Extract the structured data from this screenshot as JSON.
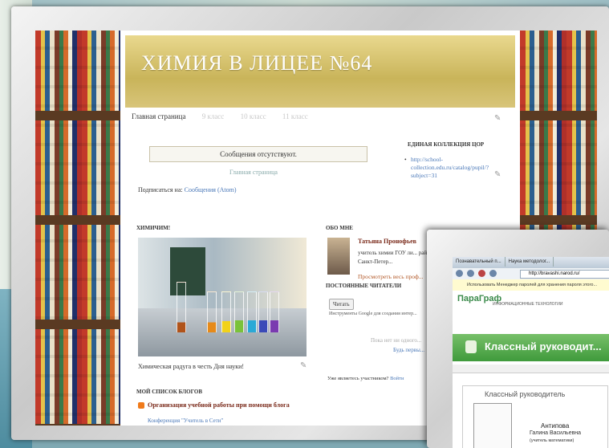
{
  "blog": {
    "title": "ХИМИЯ В ЛИЦЕЕ №64",
    "nav": [
      "Главная страница",
      "9 класс",
      "10 класс",
      "11 класс"
    ],
    "no_posts": "Сообщения отсутствуют.",
    "home_link": "Главная страница",
    "subscribe_label": "Подписаться на:",
    "subscribe_link": "Сообщения (Atom)",
    "collection_title": "ЕДИНАЯ КОЛЛЕКЦИЯ ЦОР",
    "collection_link": "http://school-collection.edu.ru/catalog/pupil/?subject=31",
    "chem_title": "ХИМИЧИМ!",
    "photo_caption": "Химическая радуга в честь Дня науки!",
    "blogs_title": "МОЙ СПИСОК БЛОГОВ",
    "blog_item": "Организация учебной работы при помощи блога",
    "blog_item_sub": "Конференция \"Учитель в Сети\"",
    "about_title": "ОБО МНЕ",
    "about_name": "Татьяна Пронофьев",
    "about_text": "учитель химии ГОУ ли... района г. Санкт-Петер...",
    "about_link": "Просмотреть весь проф...",
    "readers_title": "ПОСТОЯННЫЕ ЧИТАТЕЛИ",
    "follow_btn": "Читать",
    "follow_note": "Инструменты Google для создания интер...",
    "none_yet": "Пока нет ни одного...",
    "be_first": "Будь первы...",
    "member_q": "Уже являетесь участником?",
    "member_link": "Войти"
  },
  "overlay": {
    "tabs": [
      "Познавательный п...",
      "Наука методолог...",
      ""
    ],
    "address": "http://bravashi.narod.ru/",
    "notice": "Использовать Менеджер паролей для хранения пароля этого...",
    "logo": "ПараГраф",
    "logo_sub": "ИНФОРМАЦИОННЫЕ ТЕХНОЛОГИИ",
    "banner": "Классный руководит...",
    "panel_title": "Классный руководитель",
    "person_name": "Антипова",
    "person_patr": "Галина Васильевна",
    "person_role": "(учитель математики)"
  },
  "colors": {
    "header_gold": "#c9b45a",
    "banner_green": "#3f9a3c",
    "link_blue": "#4a78b8"
  }
}
